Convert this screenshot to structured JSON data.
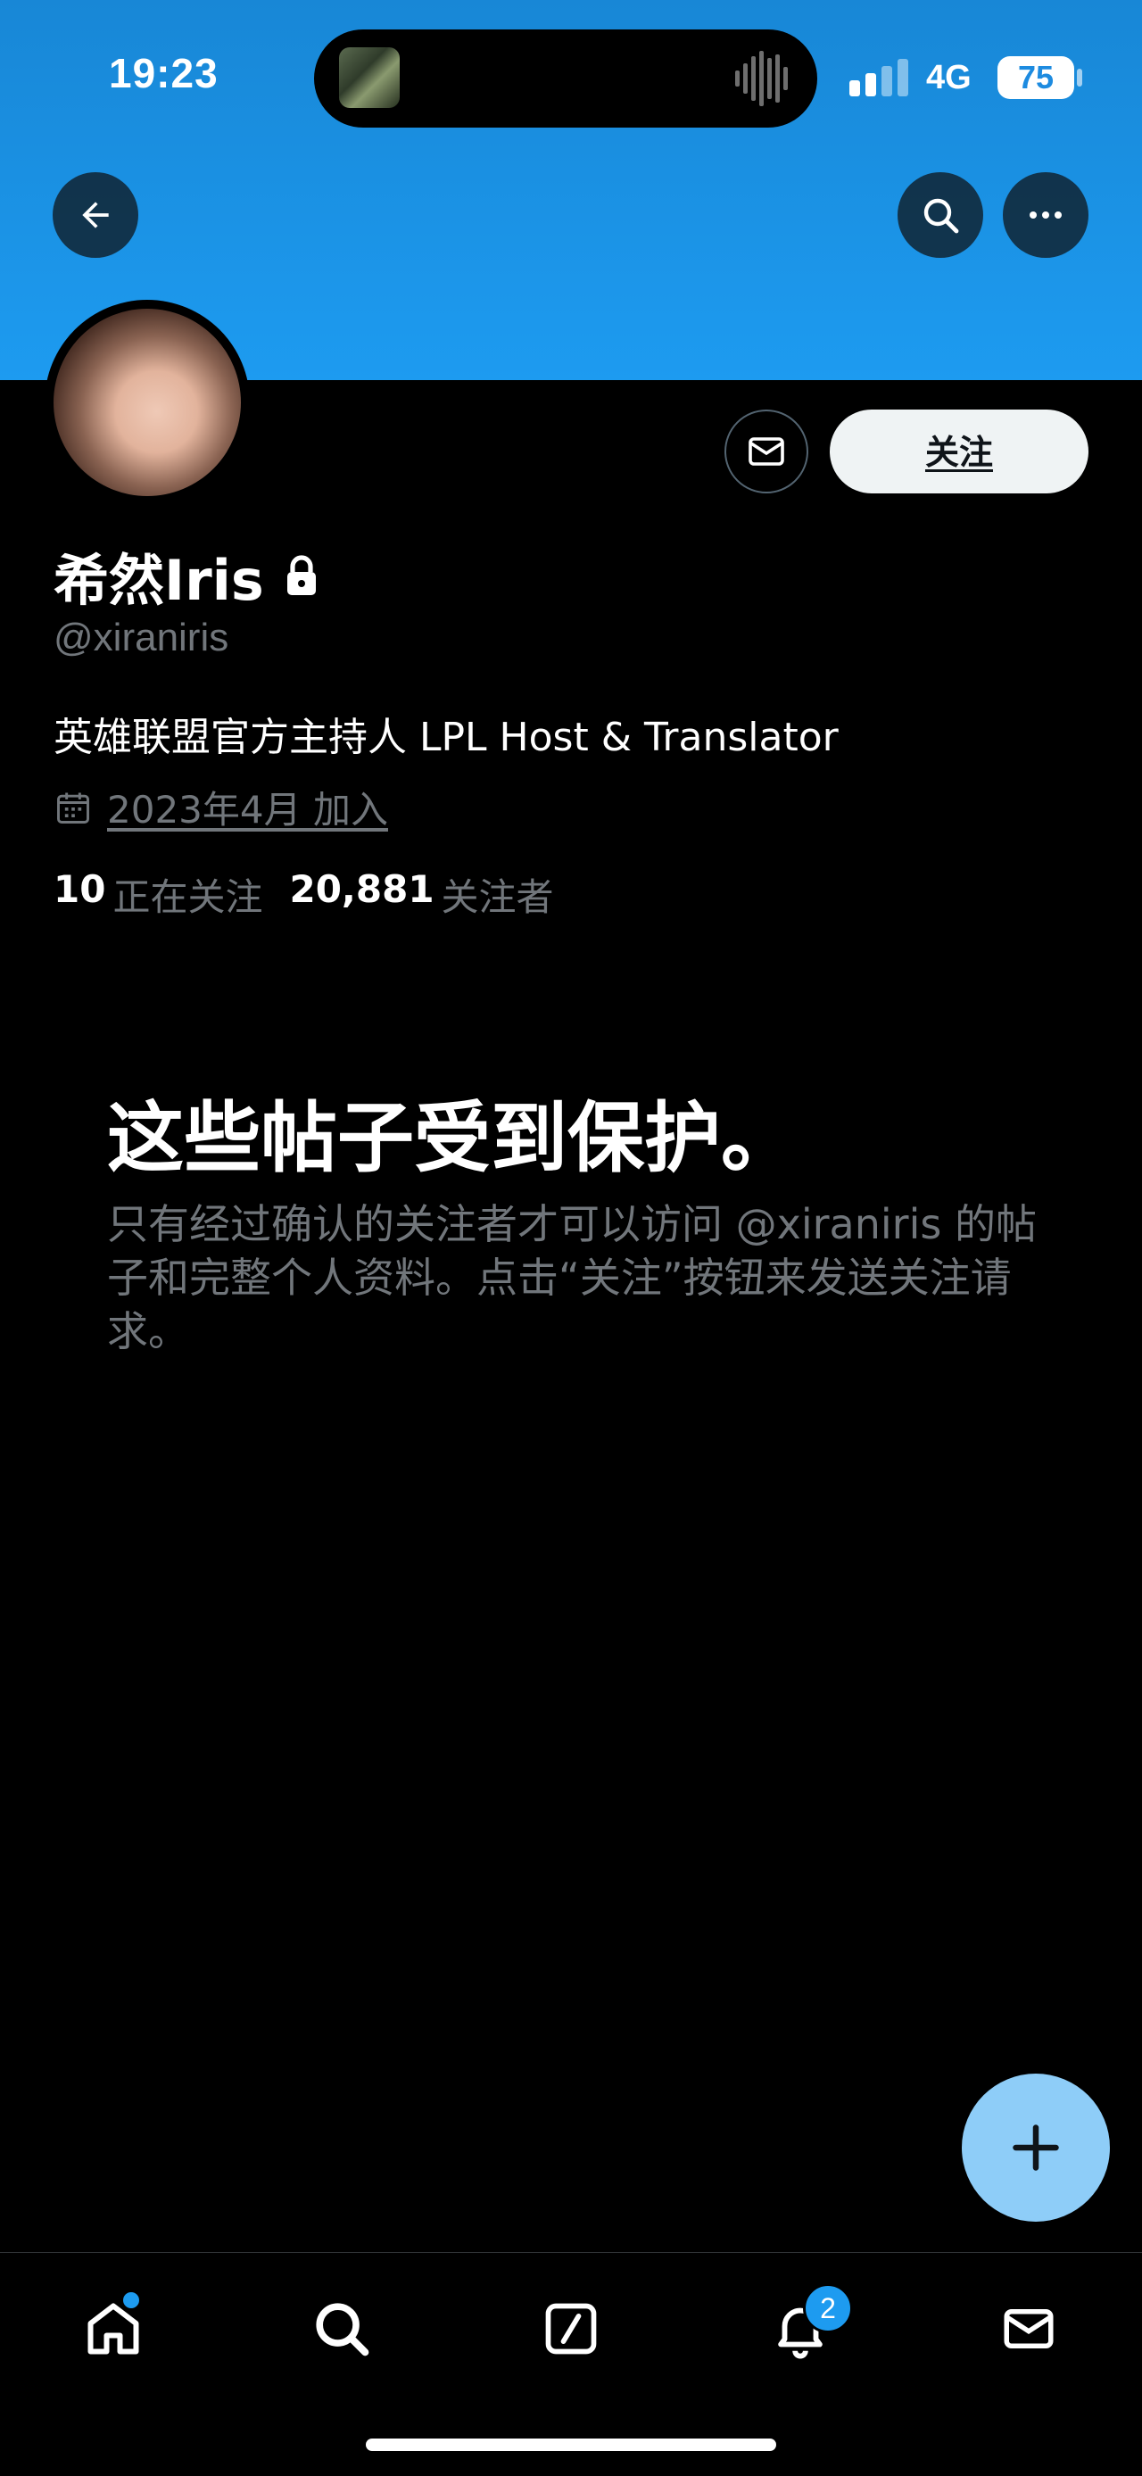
{
  "status_bar": {
    "time": "19:23",
    "network": "4G",
    "battery": "75"
  },
  "profile": {
    "display_name": "希然Iris",
    "handle": "@xiraniris",
    "bio": "英雄联盟官方主持人 LPL Host & Translator",
    "joined": "2023年4月 加入",
    "following_count": "10",
    "following_label": "正在关注",
    "followers_count": "20,881",
    "followers_label": "关注者"
  },
  "actions": {
    "follow_label": "关注"
  },
  "protected": {
    "title": "这些帖子受到保护。",
    "body": "只有经过确认的关注者才可以访问 @xiraniris 的帖子和完整个人资料。点击“关注”按钮来发送关注请求。"
  },
  "nav": {
    "notifications_badge": "2"
  },
  "colors": {
    "banner": "#1d9bf0",
    "accent": "#1d9bf0",
    "fab": "#8ecdf8",
    "muted": "#71767b"
  },
  "icons": [
    "back-arrow-icon",
    "search-icon",
    "more-icon",
    "lock-icon",
    "mail-icon",
    "calendar-icon",
    "plus-icon",
    "home-icon",
    "compose-icon",
    "bell-icon"
  ]
}
